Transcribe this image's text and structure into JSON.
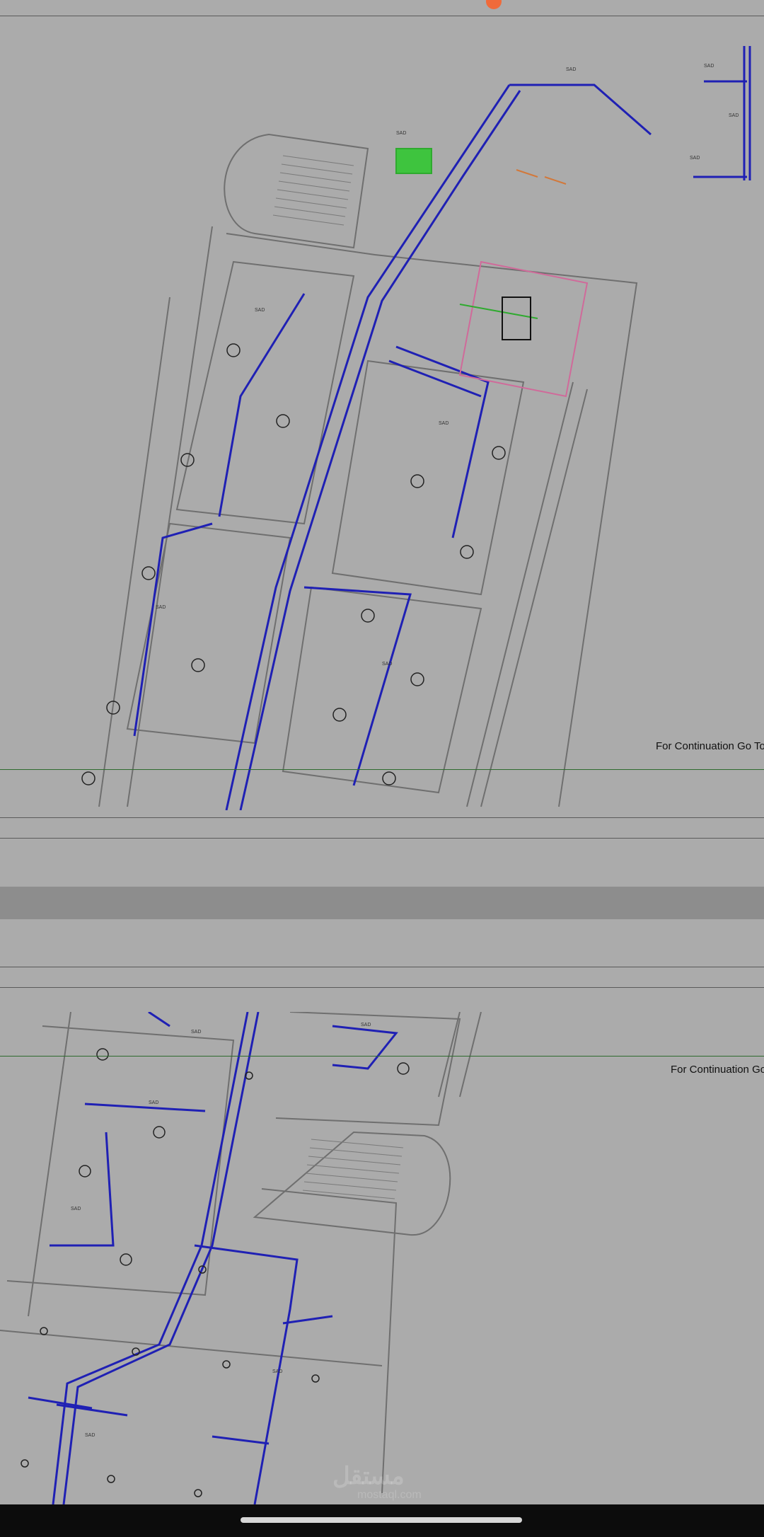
{
  "viewer": {
    "page1_note": "For Continuation Go To S",
    "page2_note": "For Continuation Go T"
  },
  "watermark": {
    "text": "مستقل",
    "sub": "mostaql.com"
  },
  "colors": {
    "duct": "#1f20b4",
    "wall": "#6f6f6f",
    "background": "#ababab",
    "note": "#111111",
    "green_line": "#2e6b2e",
    "recording_dot": "#f06a3a"
  }
}
